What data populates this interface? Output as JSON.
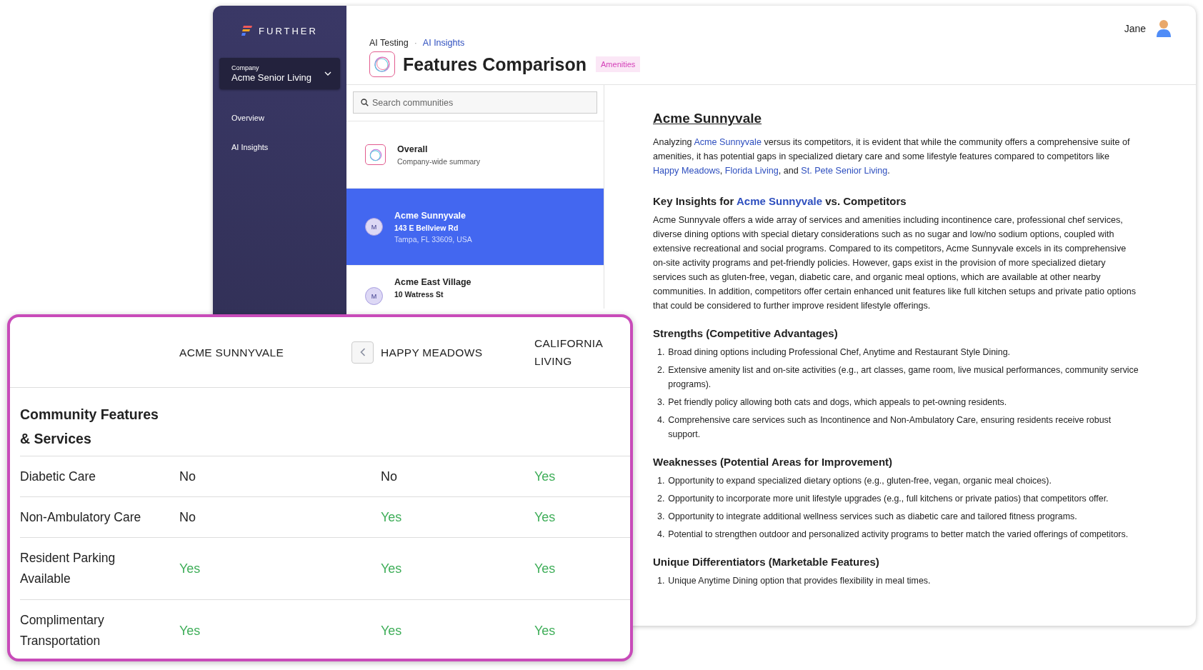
{
  "sidebar": {
    "logo": "FURTHER",
    "company": {
      "label": "Company",
      "value": "Acme Senior Living"
    },
    "items": [
      {
        "label": "Overview"
      },
      {
        "label": "AI Insights"
      }
    ]
  },
  "header": {
    "breadcrumb": [
      "AI Testing",
      "AI Insights"
    ],
    "separator": "·",
    "title": "Features Comparison",
    "badge": "Amenities"
  },
  "user": {
    "name": "Jane"
  },
  "search": {
    "placeholder": "Search communities"
  },
  "communities": [
    {
      "kind": "overall",
      "name": "Overall",
      "lines": [
        "Company-wide summary"
      ],
      "selected": false
    },
    {
      "kind": "community",
      "avatar": "M",
      "name": "Acme Sunnyvale",
      "lines": [
        "143 E Bellview Rd",
        "Tampa, FL 33609, USA"
      ],
      "selected": true
    },
    {
      "kind": "community",
      "avatar": "M",
      "name": "Acme East Village",
      "lines": [
        "10 Watress St"
      ],
      "selected": false
    }
  ],
  "content": {
    "title": "Acme Sunnyvale",
    "intro": [
      "Analyzing ",
      "Acme Sunnyvale",
      " versus its competitors, it is evident that while the community offers a comprehensive suite of amenities, it has potential gaps in specialized dietary care and some lifestyle features compared to competitors like ",
      "Happy Meadows",
      ", ",
      "Florida Living",
      ", and ",
      "St. Pete Senior Living",
      "."
    ],
    "insights_heading": [
      "Key Insights for ",
      "Acme Sunnyvale",
      " vs. Competitors"
    ],
    "insights": "Acme Sunnyvale offers a wide array of services and amenities including incontinence care, professional chef services, diverse dining options with special dietary considerations such as no sugar and low/no sodium options, coupled with extensive recreational and social programs. Compared to its competitors, Acme Sunnyvale excels in its comprehensive on-site activity programs and pet-friendly policies. However, gaps exist in the provision of more specialized dietary services such as gluten-free, vegan, diabetic care, and organic meal options, which are available at other nearby communities. In addition, competitors offer certain enhanced unit features like full kitchen setups and private patio options that could be considered to further improve resident lifestyle offerings.",
    "sections": [
      {
        "heading": "Strengths (Competitive Advantages)",
        "items": [
          {
            "num": "1.",
            "text": "Broad dining options including Professional Chef, Anytime and Restaurant Style Dining."
          },
          {
            "num": "2.",
            "text": "Extensive amenity list and on-site activities (e.g., art classes, game room, live musical performances, community service programs)."
          },
          {
            "num": "3.",
            "text": "Pet friendly policy allowing both cats and dogs, which appeals to pet-owning residents."
          },
          {
            "num": "4.",
            "text": "Comprehensive care services such as Incontinence and Non-Ambulatory Care, ensuring residents receive robust support."
          }
        ]
      },
      {
        "heading": "Weaknesses (Potential Areas for Improvement)",
        "items": [
          {
            "num": "1.",
            "text": "Opportunity to expand specialized dietary options (e.g., gluten-free, vegan, organic meal choices)."
          },
          {
            "num": "2.",
            "text": "Opportunity to incorporate more unit lifestyle upgrades (e.g., full kitchens or private patios) that competitors offer."
          },
          {
            "num": "3.",
            "text": "Opportunity to integrate additional wellness services such as diabetic care and tailored fitness programs."
          },
          {
            "num": "4.",
            "text": "Potential to strengthen outdoor and personalized activity programs to better match the varied offerings of competitors."
          }
        ]
      },
      {
        "heading": "Unique Differentiators (Marketable Features)",
        "items": [
          {
            "num": "1.",
            "text": "Unique Anytime Dining option that provides flexibility in meal times."
          }
        ]
      }
    ]
  },
  "comparison": {
    "columns": [
      "ACME SUNNYVALE",
      "HAPPY MEADOWS",
      "CALIFORNIA LIVING"
    ],
    "section": "Community Features & Services",
    "rows": [
      {
        "feature": "Diabetic Care",
        "values": [
          {
            "text": "No",
            "positive": false
          },
          {
            "text": "No",
            "positive": false
          },
          {
            "text": "Yes",
            "positive": true
          }
        ]
      },
      {
        "feature": "Non-Ambulatory Care",
        "values": [
          {
            "text": "No",
            "positive": false
          },
          {
            "text": "Yes",
            "positive": true
          },
          {
            "text": "Yes",
            "positive": true
          }
        ]
      },
      {
        "feature": "Resident Parking Available",
        "values": [
          {
            "text": "Yes",
            "positive": true
          },
          {
            "text": "Yes",
            "positive": true
          },
          {
            "text": "Yes",
            "positive": true
          }
        ]
      },
      {
        "feature": "Complimentary Transportation",
        "values": [
          {
            "text": "Yes",
            "positive": true
          },
          {
            "text": "Yes",
            "positive": true
          },
          {
            "text": "Yes",
            "positive": true
          }
        ]
      }
    ]
  }
}
